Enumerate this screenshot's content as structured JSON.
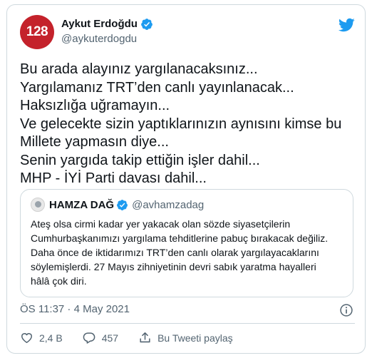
{
  "author": {
    "avatar_text": "128",
    "display_name": "Aykut Erdoğdu",
    "handle": "@aykuterdogdu"
  },
  "tweet": {
    "lines": [
      "Bu arada alayınız yargılanacaksınız...",
      "Yargılamanız TRT’den canlı yayınlanacak...",
      "Haksızlığa uğramayın...",
      "Ve gelecekte sizin yaptıklarınızın aynısını kimse bu",
      "Millete yapmasın diye...",
      "Senin yargıda takip ettiğin işler dahil...",
      "MHP - İYİ Parti davası dahil..."
    ],
    "timestamp": "ÖS 11:37 · 4 May 2021"
  },
  "quote": {
    "display_name": "HAMZA DAĞ",
    "handle": "@avhamzadag",
    "lines": [
      "Ateş olsa cirmi kadar yer yakacak olan sözde siyasetçilerin",
      "Cumhurbaşkanımızı yargılama tehditlerine pabuç bırakacak değiliz.",
      "Daha önce de iktidarımızı TRT’den canlı olarak yargılayacaklarını",
      "söylemişlerdi. 27 Mayıs zihniyetinin devri sabık yaratma hayalleri",
      "hâlâ çok diri."
    ]
  },
  "actions": {
    "like_count": "2,4 B",
    "reply_count": "457",
    "share_label": "Bu Tweeti paylaş"
  },
  "colors": {
    "accent": "#1d9bf0",
    "avatar_bg": "#c4222b",
    "muted": "#536471",
    "border": "#cfd9de"
  },
  "icons": [
    "verified-icon",
    "twitter-bird-icon",
    "info-icon",
    "heart-icon",
    "reply-icon",
    "share-icon"
  ]
}
